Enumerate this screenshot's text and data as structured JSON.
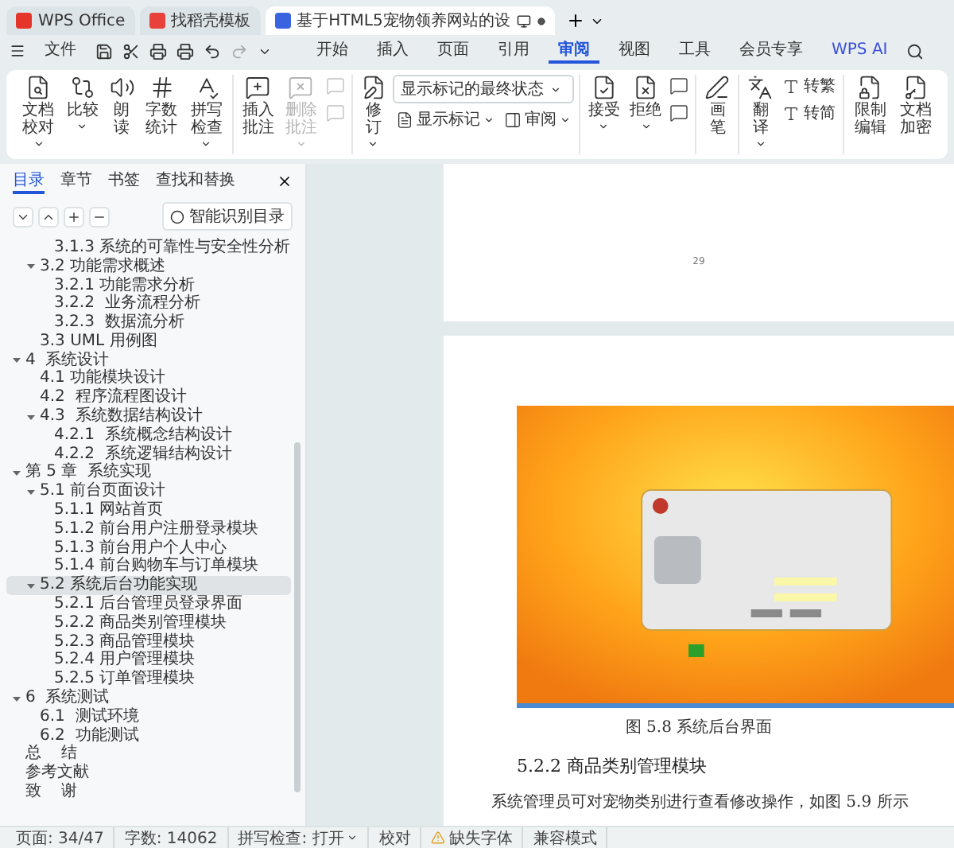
{
  "window_tabs": [
    {
      "label": "WPS Office",
      "selected": false,
      "kind": "home"
    },
    {
      "label": "找稻壳模板",
      "selected": false,
      "kind": "template"
    },
    {
      "label": "基于HTML5宠物领养网站的设",
      "selected": true,
      "kind": "document"
    }
  ],
  "menu": {
    "file": "文件",
    "tabs": [
      {
        "label": "开始",
        "selected": false
      },
      {
        "label": "插入",
        "selected": false
      },
      {
        "label": "页面",
        "selected": false
      },
      {
        "label": "引用",
        "selected": false
      },
      {
        "label": "审阅",
        "selected": true
      },
      {
        "label": "视图",
        "selected": false
      },
      {
        "label": "工具",
        "selected": false
      },
      {
        "label": "会员专享",
        "selected": false
      }
    ],
    "ai": "WPS AI"
  },
  "ribbon": {
    "groups": [
      {
        "items": [
          {
            "kind": "big",
            "label": "文档校对",
            "menu": true,
            "disabled": false
          },
          {
            "kind": "big",
            "label": "比较",
            "menu": true,
            "disabled": false
          },
          {
            "kind": "big",
            "label": "朗读",
            "menu": false,
            "disabled": false
          },
          {
            "kind": "big",
            "label": "字数统计",
            "menu": false,
            "disabled": false
          },
          {
            "kind": "big",
            "label": "拼写检查",
            "menu": true,
            "disabled": false
          }
        ]
      },
      {
        "items": [
          {
            "kind": "big",
            "label": "插入批注",
            "menu": false,
            "disabled": false
          },
          {
            "kind": "big",
            "label": "删除批注",
            "menu": true,
            "disabled": true
          },
          {
            "kind": "stack",
            "items": [
              {
                "kind": "icon",
                "disabled": true
              },
              {
                "kind": "icon",
                "disabled": true
              }
            ]
          }
        ]
      },
      {
        "items": [
          {
            "kind": "big",
            "label": "修订",
            "menu": true,
            "disabled": false
          },
          {
            "kind": "stack",
            "items": [
              {
                "kind": "select",
                "value": "显示标记的最终状态"
              },
              {
                "kind": "pair",
                "items": [
                  {
                    "kind": "small",
                    "label": "显示标记",
                    "menu": true,
                    "disabled": false
                  },
                  {
                    "kind": "small",
                    "label": "审阅",
                    "menu": true,
                    "disabled": false
                  }
                ]
              }
            ]
          }
        ]
      },
      {
        "items": [
          {
            "kind": "big",
            "label": "接受",
            "menu": true,
            "disabled": false
          },
          {
            "kind": "big",
            "label": "拒绝",
            "menu": true,
            "disabled": false
          },
          {
            "kind": "stack",
            "items": [
              {
                "kind": "icon",
                "disabled": false
              },
              {
                "kind": "icon",
                "disabled": false
              }
            ]
          }
        ]
      },
      {
        "items": [
          {
            "kind": "big",
            "label": "画笔",
            "menu": false,
            "disabled": false
          }
        ]
      },
      {
        "items": [
          {
            "kind": "big",
            "label": "翻译",
            "menu": true,
            "disabled": false
          },
          {
            "kind": "stack",
            "items": [
              {
                "kind": "small",
                "label": "转繁",
                "menu": false,
                "disabled": false
              },
              {
                "kind": "small",
                "label": "转简",
                "menu": false,
                "disabled": false
              }
            ]
          }
        ]
      },
      {
        "items": [
          {
            "kind": "big",
            "label": "限制编辑",
            "menu": false,
            "disabled": false
          },
          {
            "kind": "big",
            "label": "文档加密",
            "menu": false,
            "disabled": false
          }
        ]
      }
    ]
  },
  "nav_panel": {
    "tabs": [
      {
        "label": "目录",
        "selected": true
      },
      {
        "label": "章节",
        "selected": false
      },
      {
        "label": "书签",
        "selected": false
      },
      {
        "label": "查找和替换",
        "selected": false
      }
    ],
    "smart_toc_button": "智能识别目录",
    "toc": {
      "items": [
        {
          "children": [
            {
              "children": [
                {
                  "label": "3.1.3 系统的可靠性与安全性分析",
                  "selected": false
                }
              ]
            },
            {
              "label": "3.2 功能需求概述",
              "selected": false,
              "expanded": true,
              "children": [
                {
                  "label": "3.2.1 功能需求分析",
                  "selected": false
                },
                {
                  "label": "3.2.2  业务流程分析",
                  "selected": false
                },
                {
                  "label": "3.2.3  数据流分析",
                  "selected": false
                }
              ]
            },
            {
              "label": "3.3 UML 用例图",
              "selected": false
            }
          ]
        },
        {
          "label": "4  系统设计",
          "selected": false,
          "expanded": true,
          "children": [
            {
              "label": "4.1 功能模块设计",
              "selected": false
            },
            {
              "label": "4.2  程序流程图设计",
              "selected": false
            },
            {
              "label": "4.3  系统数据结构设计",
              "selected": false,
              "expanded": true,
              "children": [
                {
                  "label": "4.2.1  系统概念结构设计",
                  "selected": false
                },
                {
                  "label": "4.2.2  系统逻辑结构设计",
                  "selected": false
                }
              ]
            }
          ]
        },
        {
          "label": "第 5 章  系统实现",
          "selected": false,
          "expanded": true,
          "children": [
            {
              "label": "5.1 前台页面设计",
              "selected": false,
              "expanded": true,
              "children": [
                {
                  "label": "5.1.1 网站首页",
                  "selected": false
                },
                {
                  "label": "5.1.2 前台用户注册登录模块",
                  "selected": false
                },
                {
                  "label": "5.1.3 前台用户个人中心",
                  "selected": false
                },
                {
                  "label": "5.1.4 前台购物车与订单模块",
                  "selected": false
                }
              ]
            },
            {
              "label": "5.2 系统后台功能实现",
              "selected": true,
              "expanded": true,
              "children": [
                {
                  "label": "5.2.1 后台管理员登录界面",
                  "selected": false
                },
                {
                  "label": "5.2.2 商品类别管理模块",
                  "selected": false
                },
                {
                  "label": "5.2.3 商品管理模块",
                  "selected": false
                },
                {
                  "label": "5.2.4 用户管理模块",
                  "selected": false
                },
                {
                  "label": "5.2.5 订单管理模块",
                  "selected": false
                }
              ]
            }
          ]
        },
        {
          "label": "6  系统测试",
          "selected": false,
          "expanded": true,
          "children": [
            {
              "label": "6.1  测试环境",
              "selected": false
            },
            {
              "label": "6.2  功能测试",
              "selected": false
            }
          ]
        },
        {
          "label": "总    结",
          "selected": false
        },
        {
          "label": "参考文献",
          "selected": false
        },
        {
          "label": "致    谢",
          "selected": false
        }
      ]
    }
  },
  "document": {
    "page_number": "29",
    "figure_caption": "图 5.8  系统后台界面",
    "heading": "5.2.2 商品类别管理模块",
    "body": "系统管理员可对宠物类别进行查看修改操作，如图 5.9 所示"
  },
  "status_bar": {
    "left": [
      "页面: 34/47",
      "字数: 14062"
    ],
    "spell_check": "拼写检查: 打开",
    "proofread": "校对",
    "missing_fonts": "缺失字体",
    "compat_mode": "兼容模式"
  }
}
